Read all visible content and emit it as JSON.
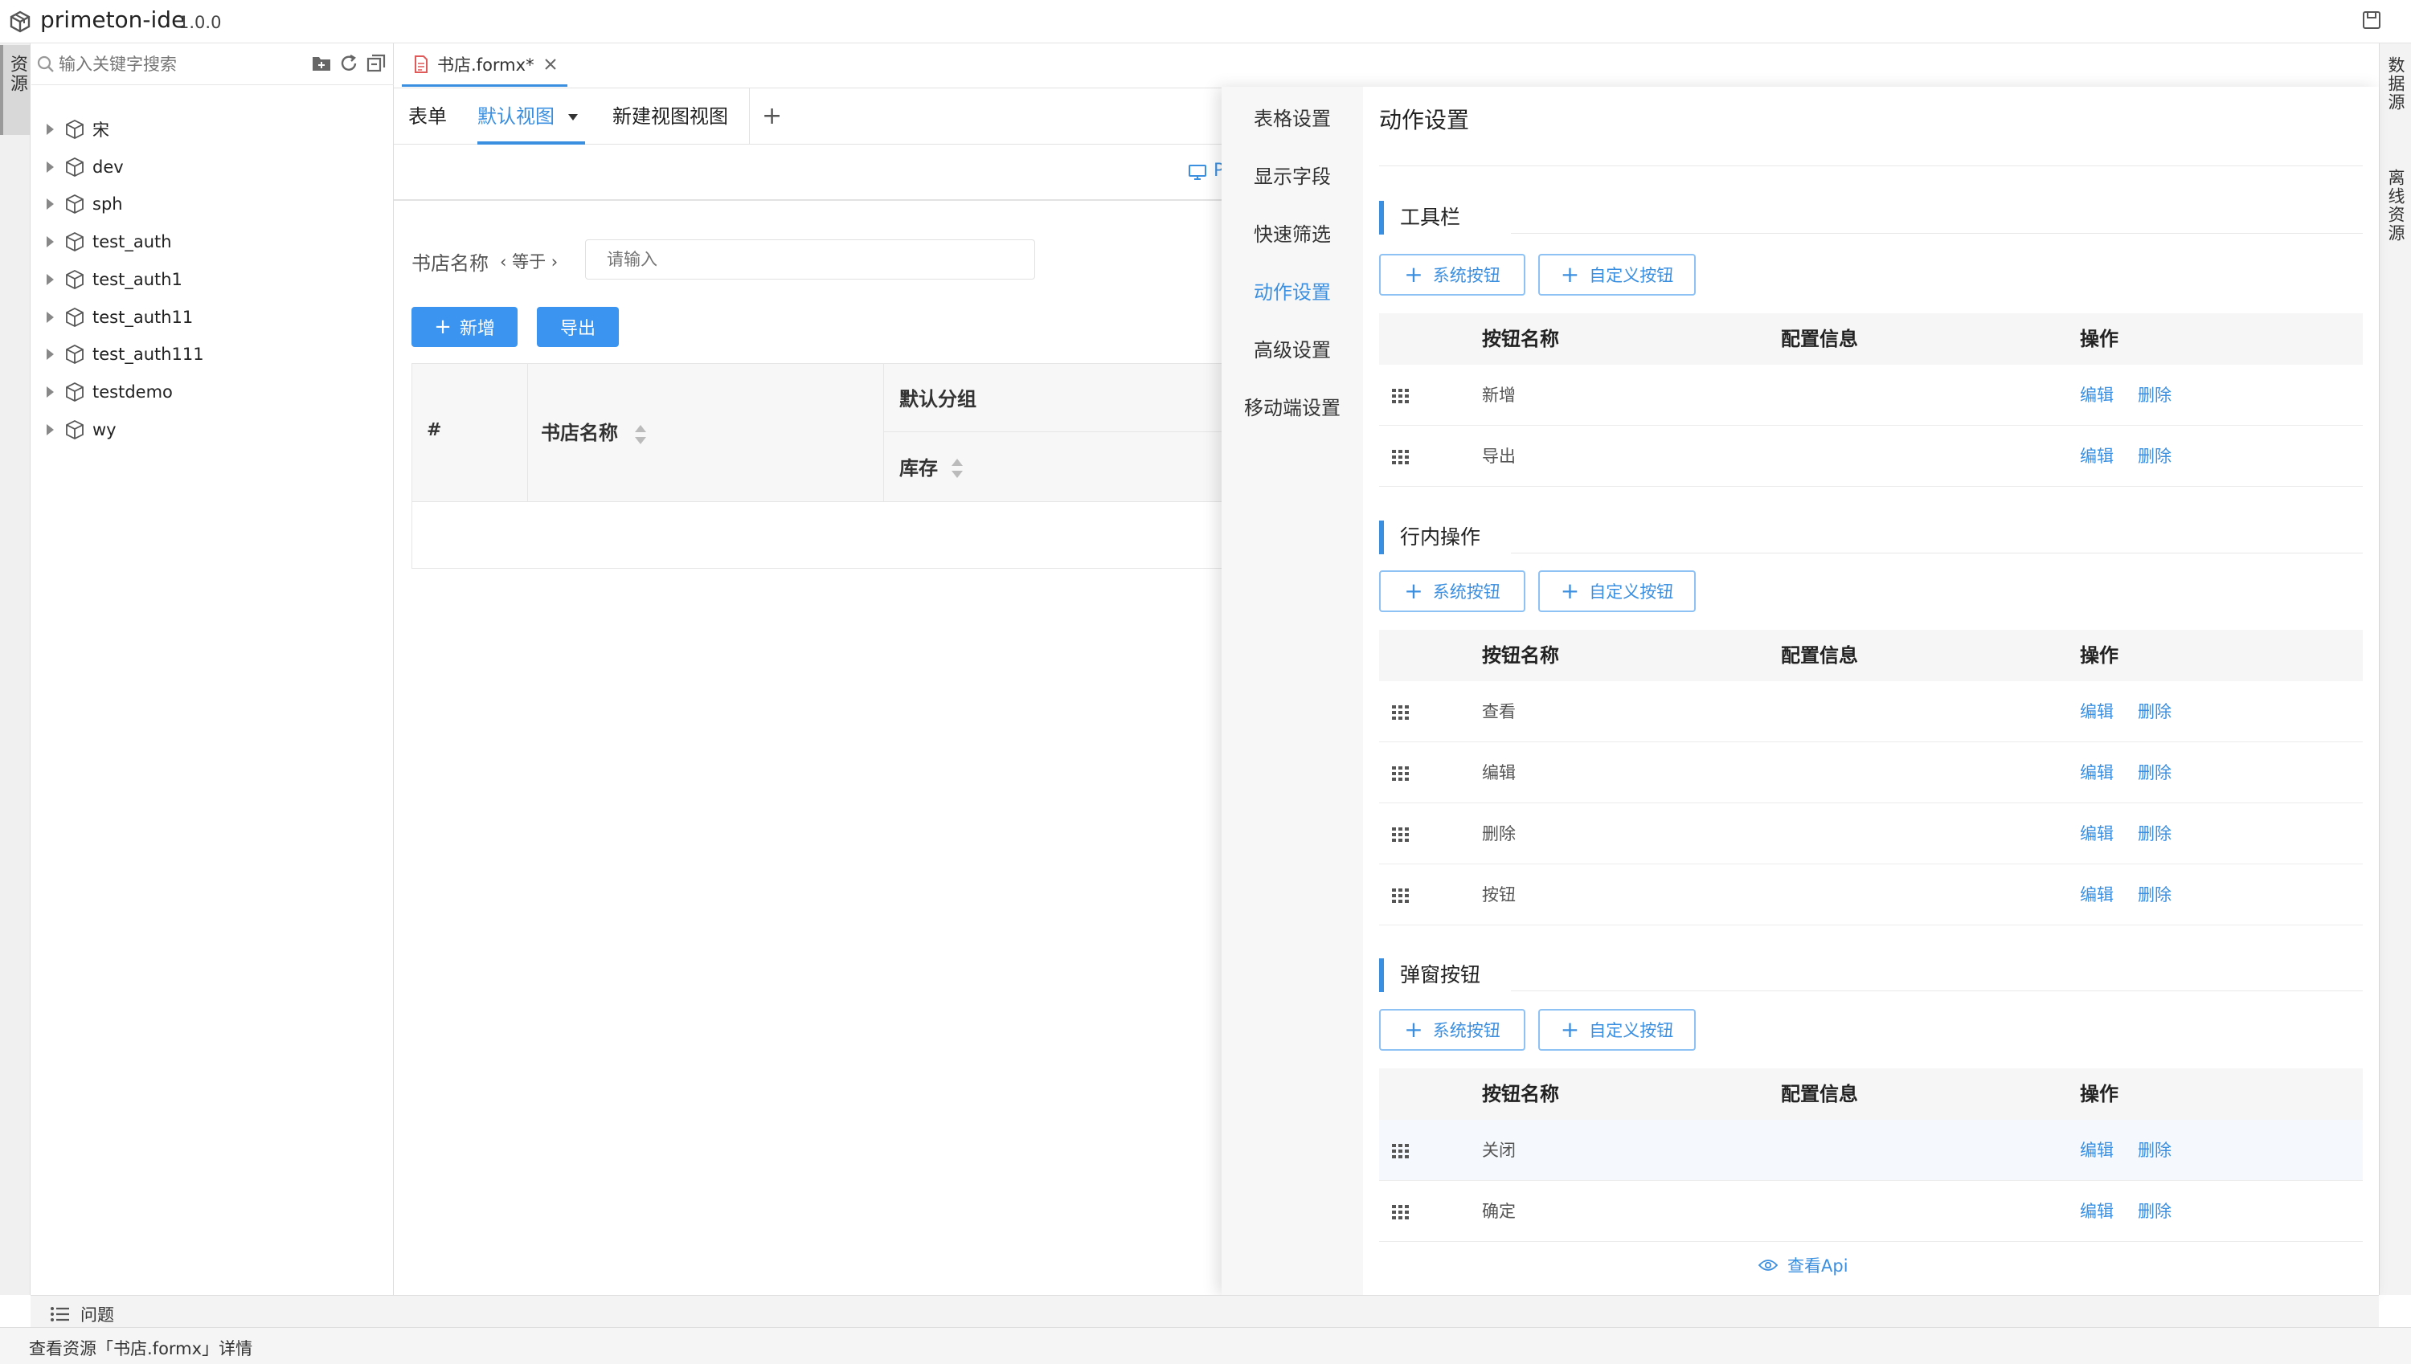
{
  "app": {
    "name": "primeton-ide",
    "version": "1.0.0"
  },
  "left_strip": {
    "tab": "资源"
  },
  "right_strip": {
    "tabs": [
      "数据源",
      "离线资源"
    ]
  },
  "explorer": {
    "search_placeholder": "输入关键字搜索",
    "items": [
      "宋",
      "dev",
      "sph",
      "test_auth",
      "test_auth1",
      "test_auth11",
      "test_auth111",
      "testdemo",
      "wy"
    ]
  },
  "file_tab": {
    "label": "书店.formx*"
  },
  "view_tabs": {
    "form": "表单",
    "default_view": "默认视图",
    "new_view": "新建视图视图",
    "add": "+"
  },
  "preview": {
    "device_label": "P",
    "filter_label": "书店名称",
    "filter_op": "等于",
    "filter_placeholder": "请输入",
    "btn_add": "新增",
    "btn_export": "导出",
    "table": {
      "col_index": "#",
      "col_name": "书店名称",
      "col_group": "默认分组",
      "col_stock": "库存"
    }
  },
  "settings_menu": {
    "items": [
      "表格设置",
      "显示字段",
      "快速筛选",
      "动作设置",
      "高级设置",
      "移动端设置"
    ],
    "active": "动作设置"
  },
  "action_settings": {
    "title": "动作设置",
    "headers": {
      "name": "按钮名称",
      "config": "配置信息",
      "ops": "操作"
    },
    "sys_btn": "系统按钮",
    "custom_btn": "自定义按钮",
    "edit": "编辑",
    "delete": "删除",
    "sections": [
      {
        "title": "工具栏",
        "rows": [
          "新增",
          "导出"
        ]
      },
      {
        "title": "行内操作",
        "rows": [
          "查看",
          "编辑",
          "删除",
          "按钮"
        ]
      },
      {
        "title": "弹窗按钮",
        "rows": [
          "关闭",
          "确定"
        ]
      }
    ],
    "view_api": "查看Api"
  },
  "bottom_panel": {
    "label": "问题"
  },
  "status": {
    "text": "查看资源「书店.formx」详情"
  },
  "colors": {
    "accent": "#3b8fe0",
    "primary_button": "#3b94f0"
  }
}
